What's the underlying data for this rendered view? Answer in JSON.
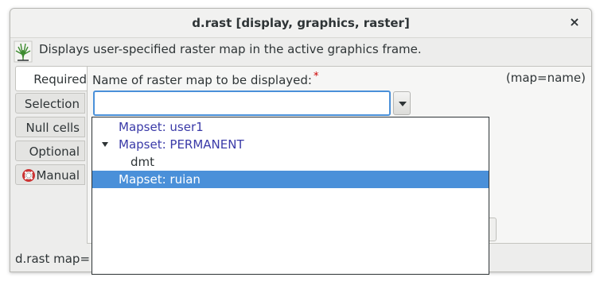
{
  "window": {
    "title": "d.rast [display, graphics, raster]",
    "close_glyph": "×",
    "description": "Displays user-specified raster map in the active graphics frame."
  },
  "tabs": [
    {
      "label": "Required",
      "active": true
    },
    {
      "label": "Selection",
      "active": false
    },
    {
      "label": "Null cells",
      "active": false
    },
    {
      "label": "Optional",
      "active": false
    },
    {
      "label": "Manual",
      "active": false,
      "icon": "lifebuoy-icon"
    }
  ],
  "parameter": {
    "label": "Name of raster map to be displayed:",
    "required_mark": "*",
    "key": "(map=name)",
    "value": ""
  },
  "dropdown": {
    "items": [
      {
        "text": "Mapset: user1",
        "type": "mapset",
        "expanded": false,
        "selected": false
      },
      {
        "text": "Mapset: PERMANENT",
        "type": "mapset",
        "expanded": true,
        "selected": false
      },
      {
        "text": "dmt",
        "type": "map",
        "selected": false
      },
      {
        "text": "Mapset: ruian",
        "type": "mapset",
        "expanded": false,
        "selected": true
      }
    ]
  },
  "command_line": "d.rast map=",
  "colors": {
    "accent": "#4a90d9",
    "mapset_text": "#3a3aa8",
    "required_star": "#cc0000"
  }
}
